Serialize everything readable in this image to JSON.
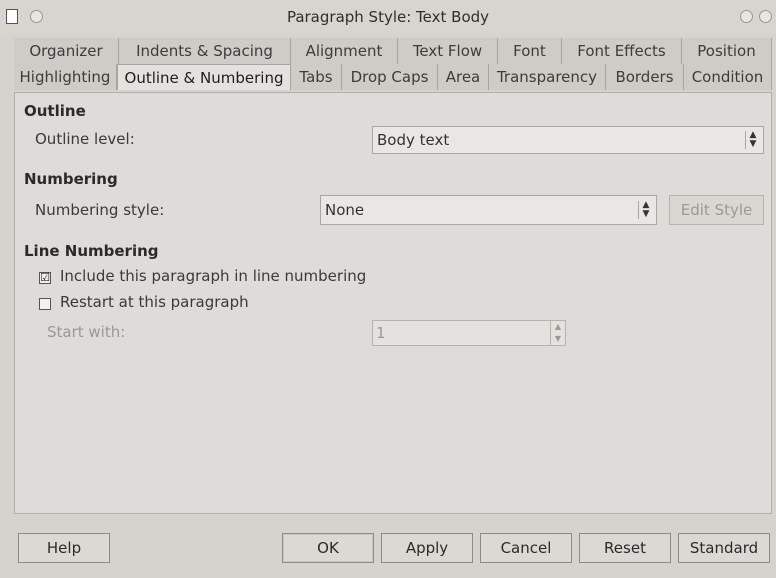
{
  "window": {
    "title": "Paragraph Style: Text Body"
  },
  "tabs_row1": [
    "Organizer",
    "Indents & Spacing",
    "Alignment",
    "Text Flow",
    "Font",
    "Font Effects",
    "Position"
  ],
  "tabs_row2": [
    "Highlighting",
    "Outline & Numbering",
    "Tabs",
    "Drop Caps",
    "Area",
    "Transparency",
    "Borders",
    "Condition"
  ],
  "active_tab": "Outline & Numbering",
  "outline": {
    "heading": "Outline",
    "level_label": "Outline level:",
    "level_value": "Body text"
  },
  "numbering": {
    "heading": "Numbering",
    "style_label": "Numbering style:",
    "style_value": "None",
    "edit_style_label": "Edit Style"
  },
  "line_numbering": {
    "heading": "Line Numbering",
    "include_label": "Include this paragraph in line numbering",
    "include_checked": true,
    "include_mark": "☑",
    "restart_label": "Restart at this paragraph",
    "restart_checked": false,
    "start_with_label": "Start with:",
    "start_with_value": "1"
  },
  "buttons": {
    "help": "Help",
    "ok": "OK",
    "apply": "Apply",
    "cancel": "Cancel",
    "reset": "Reset",
    "standard": "Standard"
  }
}
